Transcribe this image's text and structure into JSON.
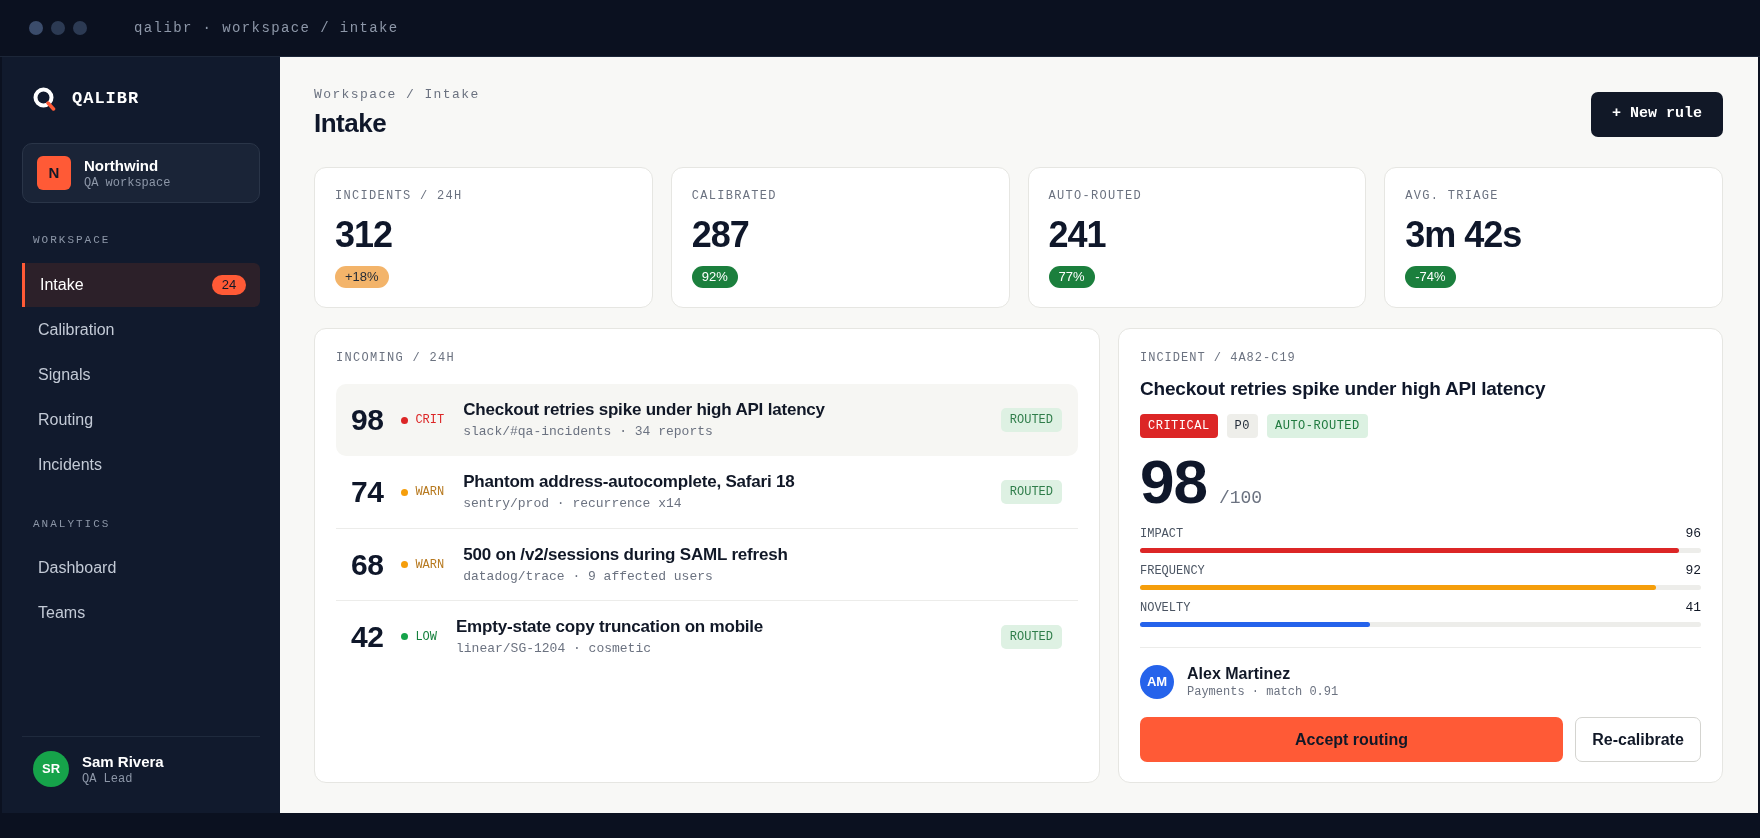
{
  "window": {
    "title": "qalibr · workspace / intake"
  },
  "sidebar": {
    "brand": "QALIBR",
    "workspace": {
      "initial": "N",
      "name": "Northwind",
      "subtitle": "QA workspace"
    },
    "sections": [
      {
        "heading": "WORKSPACE",
        "items": [
          {
            "label": "Intake",
            "selected": true,
            "badge": "24"
          },
          {
            "label": "Calibration",
            "selected": false
          },
          {
            "label": "Signals",
            "selected": false
          },
          {
            "label": "Routing",
            "selected": false
          },
          {
            "label": "Incidents",
            "selected": false
          }
        ]
      },
      {
        "heading": "ANALYTICS",
        "items": [
          {
            "label": "Dashboard",
            "selected": false
          },
          {
            "label": "Teams",
            "selected": false
          }
        ]
      }
    ],
    "user": {
      "initials": "SR",
      "name": "Sam Rivera",
      "role": "QA Lead"
    }
  },
  "header": {
    "breadcrumb": "Workspace / Intake",
    "title": "Intake",
    "action": "+ New rule"
  },
  "stats": [
    {
      "label": "INCIDENTS / 24H",
      "value": "312",
      "delta": "+18%",
      "kind": "warning"
    },
    {
      "label": "CALIBRATED",
      "value": "287",
      "delta": "92%",
      "kind": "positive"
    },
    {
      "label": "AUTO-ROUTED",
      "value": "241",
      "delta": "77%",
      "kind": "positive"
    },
    {
      "label": "AVG. TRIAGE",
      "value": "3m 42s",
      "delta": "-74%",
      "kind": "positive"
    }
  ],
  "incoming": {
    "title": "INCOMING / 24H",
    "rows": [
      {
        "score": "98",
        "severity": "CRIT",
        "kind": "crit",
        "color": "#dc2626",
        "title": "Checkout retries spike under high API latency",
        "meta": "slack/#qa-incidents · 34 reports",
        "status": "ROUTED",
        "selected": true
      },
      {
        "score": "74",
        "severity": "WARN",
        "kind": "warn",
        "color": "#f59e0b",
        "title": "Phantom address-autocomplete, Safari 18",
        "meta": "sentry/prod · recurrence x14",
        "status": "ROUTED",
        "selected": false
      },
      {
        "score": "68",
        "severity": "WARN",
        "kind": "warn",
        "color": "#f59e0b",
        "title": "500 on /v2/sessions during SAML refresh",
        "meta": "datadog/trace · 9 affected users",
        "selected": false
      },
      {
        "score": "42",
        "severity": "LOW",
        "kind": "low",
        "color": "#16a34a",
        "title": "Empty-state copy truncation on mobile",
        "meta": "linear/SG-1204 · cosmetic",
        "status": "ROUTED",
        "selected": false
      }
    ]
  },
  "incident": {
    "label": "INCIDENT / 4A82-C19",
    "title": "Checkout retries spike under high API latency",
    "tags": [
      {
        "text": "CRITICAL",
        "kind": "critical"
      },
      {
        "text": "P0",
        "kind": "priority"
      },
      {
        "text": "AUTO-ROUTED",
        "kind": "routed"
      }
    ],
    "score": "98",
    "max": "/100",
    "factors": [
      {
        "name": "IMPACT",
        "reading": "96",
        "level": 0.96,
        "color": "#dc2626"
      },
      {
        "name": "FREQUENCY",
        "reading": "92",
        "level": 0.92,
        "color": "#f59e0b"
      },
      {
        "name": "NOVELTY",
        "reading": "41",
        "level": 0.41,
        "color": "#2563eb"
      }
    ],
    "assignee": {
      "initials": "AM",
      "name": "Alex Martinez",
      "detail": "Payments · match 0.91"
    },
    "actions": [
      {
        "label": "Accept routing",
        "kind": "primary"
      },
      {
        "label": "Re-calibrate",
        "kind": "secondary"
      }
    ]
  }
}
